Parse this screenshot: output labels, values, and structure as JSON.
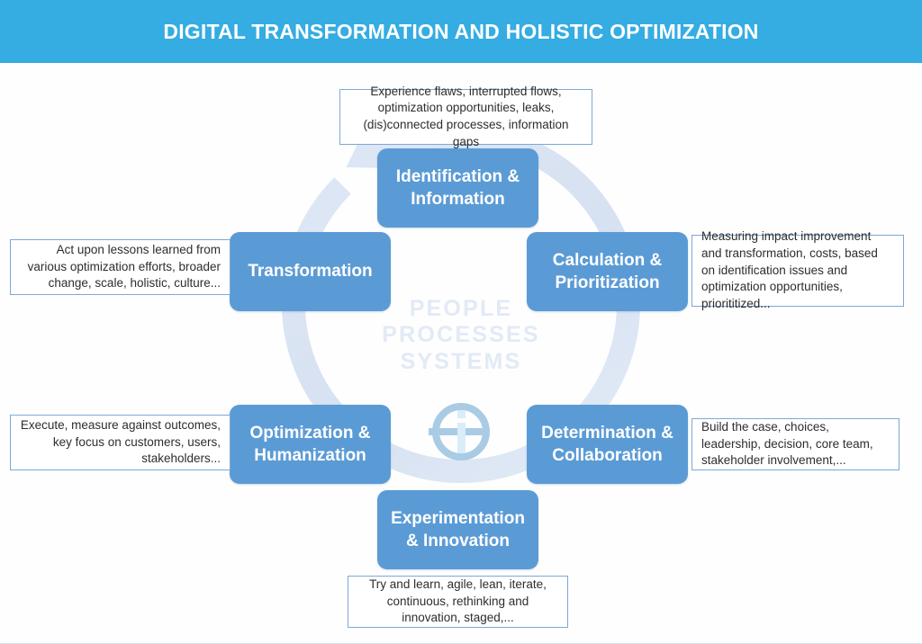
{
  "header": {
    "title": "DIGITAL TRANSFORMATION AND HOLISTIC OPTIMIZATION",
    "background_color": "#35ace2",
    "text_color": "#ffffff"
  },
  "colors": {
    "stage_box": "#5b9bd5",
    "desc_border": "#7ba9d8",
    "ring": "#dbe5f3",
    "center_text": "#e2eaf6",
    "logo": "#a9cbe3",
    "page_background": "#fefefe"
  },
  "center": {
    "words": [
      "PEOPLE",
      "PROCESSES",
      "SYSTEMS"
    ],
    "logo_name": "ig-circle-logo"
  },
  "diagram": {
    "type": "cycle",
    "direction": "clockwise",
    "stages": [
      {
        "id": "identification",
        "label": "Identification & Information",
        "position": "top",
        "description": "Experience flaws, interrupted flows, optimization opportunities, leaks, (dis)connected processes, information gaps",
        "description_lines": [
          "Experience flaws, interrupted flows,",
          "optimization opportunities, leaks,",
          "(dis)connected processes, information gaps"
        ],
        "description_align": "center"
      },
      {
        "id": "calculation",
        "label": "Calculation & Prioritization",
        "position": "upper-right",
        "description": "Measuring impact improvement and transformation, costs, based on identification issues and optimization opportunities, priorititized...",
        "description_lines": [
          "Measuring impact improvement and",
          "transformation, costs, based on",
          "identification issues and optimization",
          "opportunities, priorititized..."
        ],
        "description_align": "left"
      },
      {
        "id": "determination",
        "label": "Determination & Collaboration",
        "position": "lower-right",
        "description": "Build the case, choices, leadership, decision, core team, stakeholder involvement,...",
        "description_lines": [
          "Build the case, choices, leadership,",
          "decision, core team, stakeholder",
          "involvement,..."
        ],
        "description_align": "left"
      },
      {
        "id": "experimentation",
        "label": "Experimentation & Innovation",
        "position": "bottom",
        "description": "Try and learn, agile, lean, iterate, continuous, rethinking and innovation, staged,...",
        "description_lines": [
          "Try and learn, agile, lean, iterate,",
          "continuous, rethinking and innovation,",
          "staged,..."
        ],
        "description_align": "center"
      },
      {
        "id": "optimization",
        "label": "Optimization & Humanization",
        "position": "lower-left",
        "description": "Execute, measure against outcomes, key focus on customers, users, stakeholders...",
        "description_lines": [
          "Execute, measure against outcomes,",
          "key focus on customers, users,",
          "stakeholders..."
        ],
        "description_align": "right"
      },
      {
        "id": "transformation",
        "label": "Transformation",
        "position": "upper-left",
        "description": "Act upon lessons learned from various optimization efforts, broader change, scale, holistic, culture...",
        "description_lines": [
          "Act upon lessons learned from various",
          "optimization efforts, broader change,",
          "scale, holistic, culture..."
        ],
        "description_align": "right"
      }
    ]
  }
}
